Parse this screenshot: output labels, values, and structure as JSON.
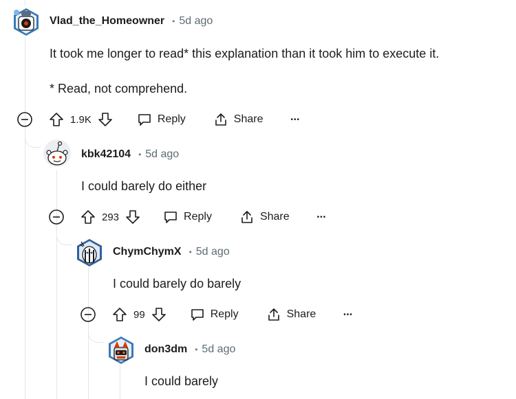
{
  "comments": [
    {
      "username": "Vlad_the_Homeowner",
      "time": "5d ago",
      "body": "It took me longer to read* this explanation than it took him to execute it.",
      "body2": "* Read, not comprehend.",
      "votes": "1.9K",
      "reply_label": "Reply",
      "share_label": "Share"
    },
    {
      "username": "kbk42104",
      "time": "5d ago",
      "body": "I could barely do either",
      "votes": "293",
      "reply_label": "Reply",
      "share_label": "Share"
    },
    {
      "username": "ChymChymX",
      "time": "5d ago",
      "body": "I could barely do barely",
      "votes": "99",
      "reply_label": "Reply",
      "share_label": "Share"
    },
    {
      "username": "don3dm",
      "time": "5d ago",
      "body": "I could barely"
    }
  ],
  "separator": "•",
  "more_glyph": "•••",
  "icons": {
    "collapse": "collapse-icon",
    "upvote": "upvote-icon",
    "downvote": "downvote-icon",
    "reply": "reply-icon",
    "share": "share-icon",
    "more": "more-options-icon"
  },
  "colors": {
    "text": "#1c1c1c",
    "meta": "#5c6c74",
    "thread_line": "#e3e5e8"
  }
}
